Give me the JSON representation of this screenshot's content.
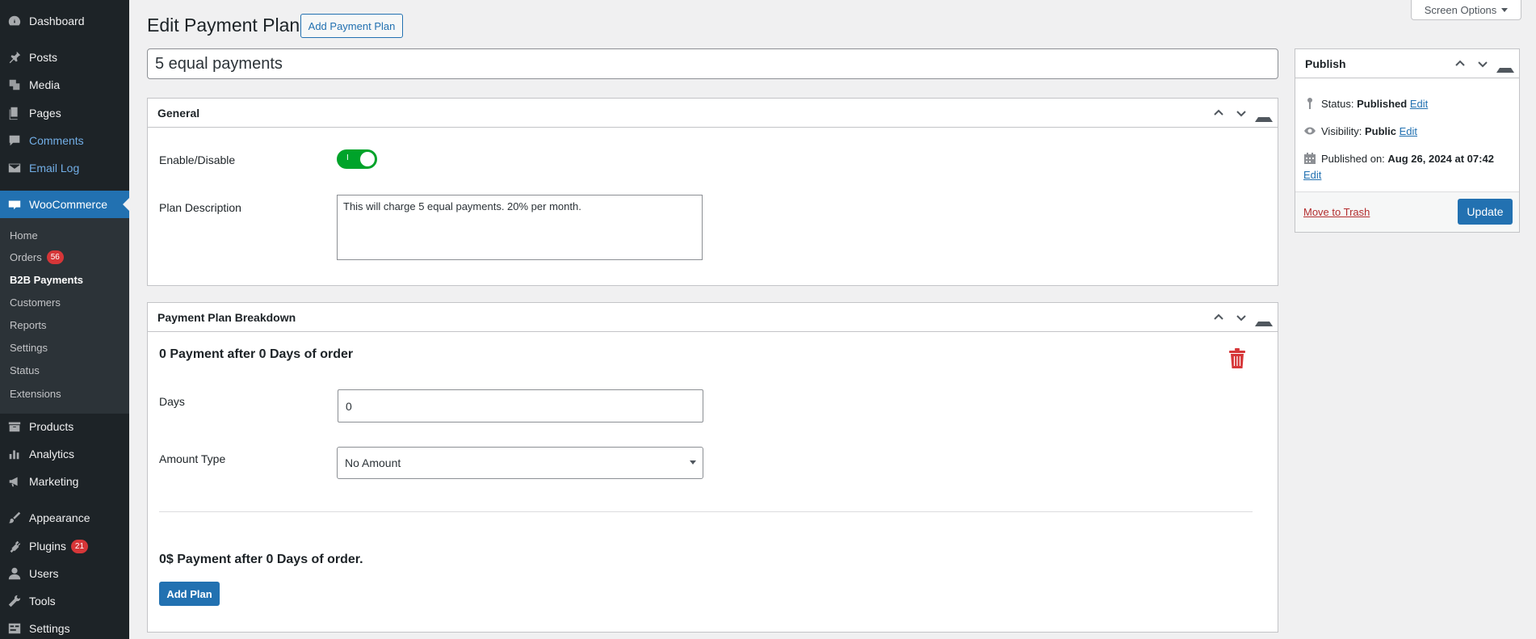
{
  "sidebar": {
    "items": [
      {
        "label": "Dashboard",
        "icon": "dashboard-icon"
      },
      {
        "label": "Posts",
        "icon": "pin-icon"
      },
      {
        "label": "Media",
        "icon": "media-icon"
      },
      {
        "label": "Pages",
        "icon": "pages-icon"
      },
      {
        "label": "Comments",
        "icon": "comment-icon"
      },
      {
        "label": "Email Log",
        "icon": "email-icon"
      },
      {
        "label": "WooCommerce",
        "icon": "woo-icon"
      },
      {
        "label": "Products",
        "icon": "archive-icon"
      },
      {
        "label": "Analytics",
        "icon": "chart-icon"
      },
      {
        "label": "Marketing",
        "icon": "megaphone-icon"
      },
      {
        "label": "Appearance",
        "icon": "brush-icon"
      },
      {
        "label": "Plugins",
        "icon": "plugin-icon",
        "badge": "21"
      },
      {
        "label": "Users",
        "icon": "user-icon"
      },
      {
        "label": "Tools",
        "icon": "wrench-icon"
      },
      {
        "label": "Settings",
        "icon": "settings-icon"
      }
    ],
    "submenu": [
      {
        "label": "Home"
      },
      {
        "label": "Orders",
        "badge": "56"
      },
      {
        "label": "B2B Payments"
      },
      {
        "label": "Customers"
      },
      {
        "label": "Reports"
      },
      {
        "label": "Settings"
      },
      {
        "label": "Status"
      },
      {
        "label": "Extensions"
      }
    ]
  },
  "header": {
    "title": "Edit Payment Plan",
    "add_button": "Add Payment Plan",
    "screen_options": "Screen Options"
  },
  "post_title": "5 equal payments",
  "general": {
    "title": "General",
    "enable_label": "Enable/Disable",
    "toggle_mark": "I",
    "toggle_on": true,
    "description_label": "Plan Description",
    "description_value": "This will charge 5 equal payments. 20% per month."
  },
  "breakdown": {
    "title": "Payment Plan Breakdown",
    "row_heading": "0 Payment after 0 Days of order",
    "days_label": "Days",
    "days_value": "0",
    "amount_type_label": "Amount Type",
    "amount_type_value": "No Amount",
    "summary": "0$ Payment after 0 Days of order.",
    "add_plan_button": "Add Plan"
  },
  "publish": {
    "title": "Publish",
    "status_label": "Status:",
    "status_value": "Published",
    "visibility_label": "Visibility:",
    "visibility_value": "Public",
    "published_label": "Published on:",
    "published_value": "Aug 26, 2024 at 07:42",
    "edit_link": "Edit",
    "trash_link": "Move to Trash",
    "update_button": "Update"
  },
  "colors": {
    "sidebar_bg": "#1d2327",
    "accent": "#2271b1",
    "toggle_on": "#00a32a",
    "badge": "#d63638",
    "trash_icon": "#d63638"
  }
}
